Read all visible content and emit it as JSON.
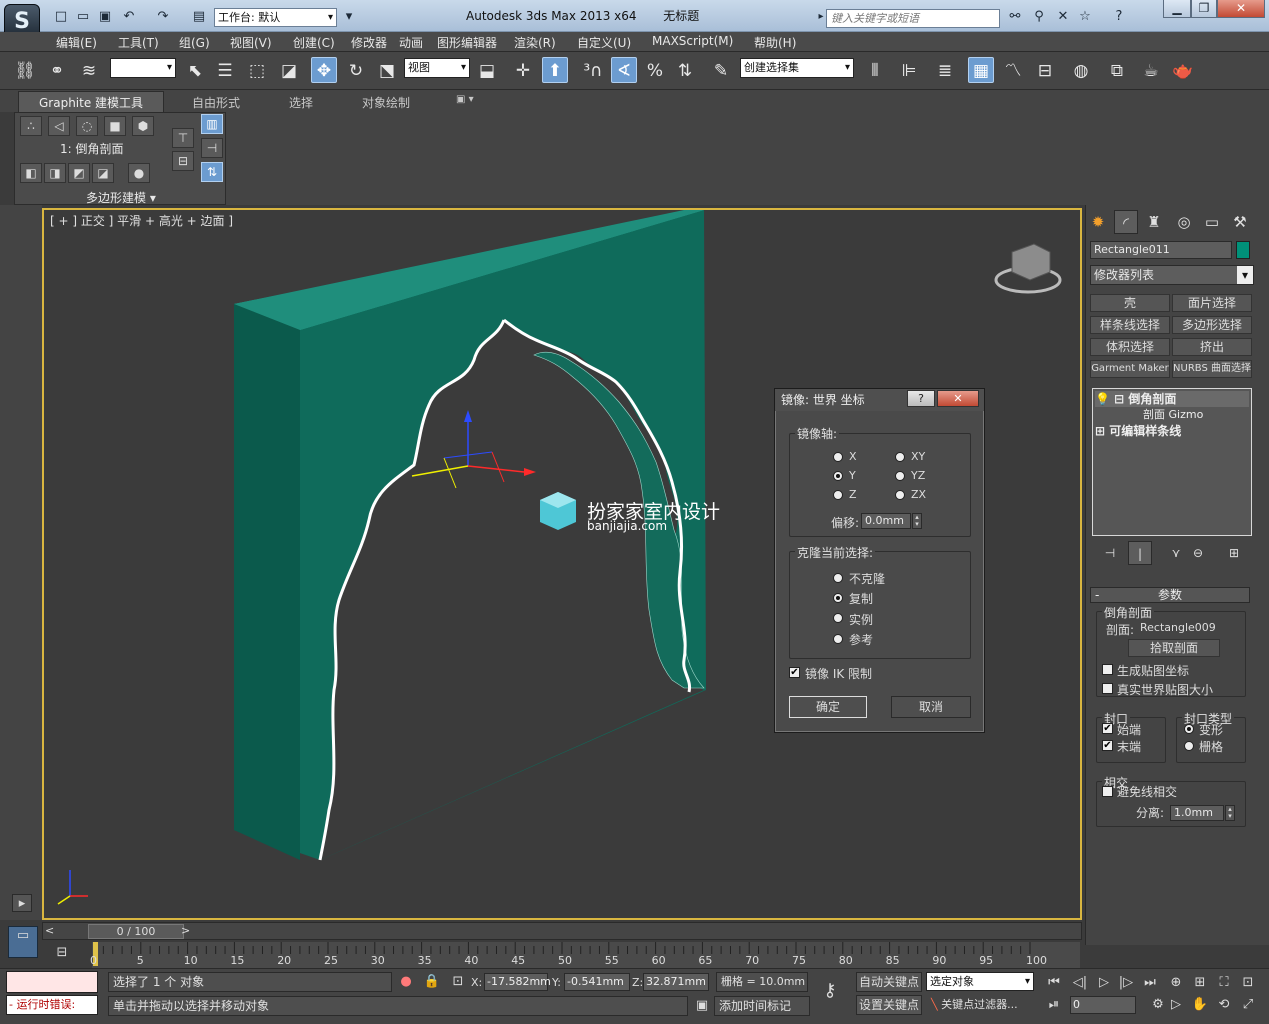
{
  "titlebar": {
    "workspace": "工作台: 默认",
    "title": "Autodesk 3ds Max  2013 x64",
    "doc": "无标题",
    "search_placeholder": "键入关键字或短语"
  },
  "menu": [
    "编辑(E)",
    "工具(T)",
    "组(G)",
    "视图(V)",
    "创建(C)",
    "修改器",
    "动画",
    "图形编辑器",
    "渲染(R)",
    "自定义(U)",
    "MAXScript(M)",
    "帮助(H)"
  ],
  "toolbar": {
    "ref_coord": "视图",
    "selection_set": "创建选择集"
  },
  "ribbon": {
    "tabs": [
      "Graphite 建模工具",
      "自由形式",
      "选择",
      "对象绘制"
    ],
    "current_label": "1: 倒角剖面",
    "panel_label": "多边形建模"
  },
  "viewport": {
    "label": "[ + ] 正交 ] 平滑 + 高光 + 边面 ]",
    "watermark_cn": "扮家家室内设计",
    "watermark_en": "banjiajia.com",
    "accent": "#d9b640",
    "object_color": "#009179"
  },
  "command_panel": {
    "object_name": "Rectangle011",
    "modifier_list": "修改器列表",
    "buttons": [
      "壳",
      "面片选择",
      "样条线选择",
      "多边形选择",
      "体积选择",
      "挤出",
      "Garment Maker",
      "NURBS 曲面选择"
    ],
    "stack": [
      "倒角剖面",
      "剖面 Gizmo",
      "可编辑样条线"
    ],
    "params": {
      "rollout_title": "参数",
      "group_profile": "倒角剖面",
      "profile_label": "剖面:",
      "profile_value": "Rectangle009",
      "pick_button": "拾取剖面",
      "gen_mapping": "生成贴图坐标",
      "real_world": "真实世界贴图大小",
      "cap_title": "封口",
      "cap_start": "始端",
      "cap_end": "末端",
      "cap_type_title": "封口类型",
      "morph": "变形",
      "grid": "栅格",
      "intersect_title": "相交",
      "avoid": "避免线相交",
      "sep_label": "分离:",
      "sep_value": "1.0mm"
    }
  },
  "dialog": {
    "title": "镜像: 世界 坐标",
    "axis_title": "镜像轴:",
    "axes": [
      "X",
      "Y",
      "Z",
      "XY",
      "YZ",
      "ZX"
    ],
    "selected_axis": "Y",
    "offset_label": "偏移:",
    "offset_value": "0.0mm",
    "clone_title": "克隆当前选择:",
    "clone_options": [
      "不克隆",
      "复制",
      "实例",
      "参考"
    ],
    "selected_clone": "复制",
    "ik_label": "镜像 IK 限制",
    "ok": "确定",
    "cancel": "取消"
  },
  "timeline": {
    "frame": "0 / 100",
    "ticks": [
      "0",
      "5",
      "10",
      "15",
      "20",
      "25",
      "30",
      "35",
      "40",
      "45",
      "50",
      "55",
      "60",
      "65",
      "70",
      "75",
      "80",
      "85",
      "90",
      "95",
      "100"
    ]
  },
  "status": {
    "maxscript_label": "运行时错误:",
    "selected": "选择了 1 个 对象",
    "prompt": "单击并拖动以选择并移动对象",
    "x_label": "X:",
    "x": "-17.582mm",
    "y_label": "Y:",
    "y": "-0.541mm",
    "z_label": "Z:",
    "z": "32.871mm",
    "grid": "栅格 = 10.0mm",
    "auto_key": "自动关键点",
    "set_key": "设置关键点",
    "key_mode": "选定对象",
    "key_filter": "关键点过滤器...",
    "add_time_tag": "添加时间标记",
    "frame_input": "0"
  }
}
